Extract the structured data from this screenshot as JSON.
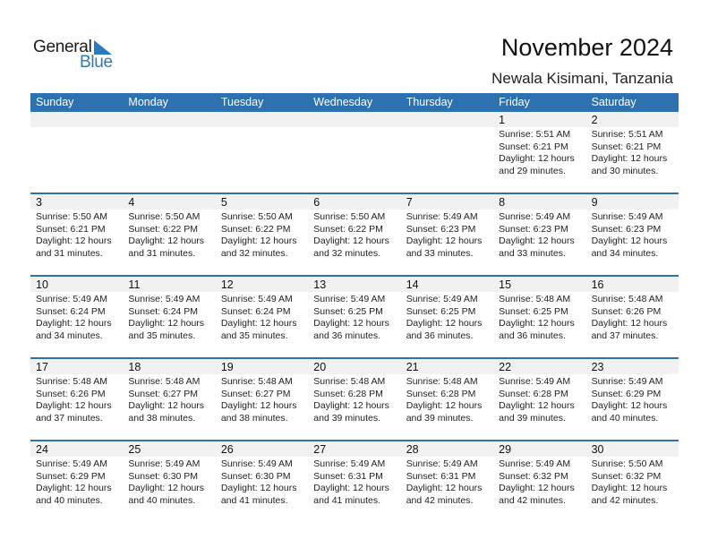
{
  "logo": {
    "word1": "General",
    "word2": "Blue",
    "accent": "#2a7ac0"
  },
  "header": {
    "title": "November 2024",
    "location": "Newala Kisimani, Tanzania"
  },
  "colors": {
    "header_bg": "#2e71b1",
    "date_row_bg": "#f1f1f1"
  },
  "weekdays": [
    "Sunday",
    "Monday",
    "Tuesday",
    "Wednesday",
    "Thursday",
    "Friday",
    "Saturday"
  ],
  "weeks": [
    [
      null,
      null,
      null,
      null,
      null,
      {
        "day": "1",
        "sunrise": "Sunrise: 5:51 AM",
        "sunset": "Sunset: 6:21 PM",
        "daylight1": "Daylight: 12 hours",
        "daylight2": "and 29 minutes."
      },
      {
        "day": "2",
        "sunrise": "Sunrise: 5:51 AM",
        "sunset": "Sunset: 6:21 PM",
        "daylight1": "Daylight: 12 hours",
        "daylight2": "and 30 minutes."
      }
    ],
    [
      {
        "day": "3",
        "sunrise": "Sunrise: 5:50 AM",
        "sunset": "Sunset: 6:21 PM",
        "daylight1": "Daylight: 12 hours",
        "daylight2": "and 31 minutes."
      },
      {
        "day": "4",
        "sunrise": "Sunrise: 5:50 AM",
        "sunset": "Sunset: 6:22 PM",
        "daylight1": "Daylight: 12 hours",
        "daylight2": "and 31 minutes."
      },
      {
        "day": "5",
        "sunrise": "Sunrise: 5:50 AM",
        "sunset": "Sunset: 6:22 PM",
        "daylight1": "Daylight: 12 hours",
        "daylight2": "and 32 minutes."
      },
      {
        "day": "6",
        "sunrise": "Sunrise: 5:50 AM",
        "sunset": "Sunset: 6:22 PM",
        "daylight1": "Daylight: 12 hours",
        "daylight2": "and 32 minutes."
      },
      {
        "day": "7",
        "sunrise": "Sunrise: 5:49 AM",
        "sunset": "Sunset: 6:23 PM",
        "daylight1": "Daylight: 12 hours",
        "daylight2": "and 33 minutes."
      },
      {
        "day": "8",
        "sunrise": "Sunrise: 5:49 AM",
        "sunset": "Sunset: 6:23 PM",
        "daylight1": "Daylight: 12 hours",
        "daylight2": "and 33 minutes."
      },
      {
        "day": "9",
        "sunrise": "Sunrise: 5:49 AM",
        "sunset": "Sunset: 6:23 PM",
        "daylight1": "Daylight: 12 hours",
        "daylight2": "and 34 minutes."
      }
    ],
    [
      {
        "day": "10",
        "sunrise": "Sunrise: 5:49 AM",
        "sunset": "Sunset: 6:24 PM",
        "daylight1": "Daylight: 12 hours",
        "daylight2": "and 34 minutes."
      },
      {
        "day": "11",
        "sunrise": "Sunrise: 5:49 AM",
        "sunset": "Sunset: 6:24 PM",
        "daylight1": "Daylight: 12 hours",
        "daylight2": "and 35 minutes."
      },
      {
        "day": "12",
        "sunrise": "Sunrise: 5:49 AM",
        "sunset": "Sunset: 6:24 PM",
        "daylight1": "Daylight: 12 hours",
        "daylight2": "and 35 minutes."
      },
      {
        "day": "13",
        "sunrise": "Sunrise: 5:49 AM",
        "sunset": "Sunset: 6:25 PM",
        "daylight1": "Daylight: 12 hours",
        "daylight2": "and 36 minutes."
      },
      {
        "day": "14",
        "sunrise": "Sunrise: 5:49 AM",
        "sunset": "Sunset: 6:25 PM",
        "daylight1": "Daylight: 12 hours",
        "daylight2": "and 36 minutes."
      },
      {
        "day": "15",
        "sunrise": "Sunrise: 5:48 AM",
        "sunset": "Sunset: 6:25 PM",
        "daylight1": "Daylight: 12 hours",
        "daylight2": "and 36 minutes."
      },
      {
        "day": "16",
        "sunrise": "Sunrise: 5:48 AM",
        "sunset": "Sunset: 6:26 PM",
        "daylight1": "Daylight: 12 hours",
        "daylight2": "and 37 minutes."
      }
    ],
    [
      {
        "day": "17",
        "sunrise": "Sunrise: 5:48 AM",
        "sunset": "Sunset: 6:26 PM",
        "daylight1": "Daylight: 12 hours",
        "daylight2": "and 37 minutes."
      },
      {
        "day": "18",
        "sunrise": "Sunrise: 5:48 AM",
        "sunset": "Sunset: 6:27 PM",
        "daylight1": "Daylight: 12 hours",
        "daylight2": "and 38 minutes."
      },
      {
        "day": "19",
        "sunrise": "Sunrise: 5:48 AM",
        "sunset": "Sunset: 6:27 PM",
        "daylight1": "Daylight: 12 hours",
        "daylight2": "and 38 minutes."
      },
      {
        "day": "20",
        "sunrise": "Sunrise: 5:48 AM",
        "sunset": "Sunset: 6:28 PM",
        "daylight1": "Daylight: 12 hours",
        "daylight2": "and 39 minutes."
      },
      {
        "day": "21",
        "sunrise": "Sunrise: 5:48 AM",
        "sunset": "Sunset: 6:28 PM",
        "daylight1": "Daylight: 12 hours",
        "daylight2": "and 39 minutes."
      },
      {
        "day": "22",
        "sunrise": "Sunrise: 5:49 AM",
        "sunset": "Sunset: 6:28 PM",
        "daylight1": "Daylight: 12 hours",
        "daylight2": "and 39 minutes."
      },
      {
        "day": "23",
        "sunrise": "Sunrise: 5:49 AM",
        "sunset": "Sunset: 6:29 PM",
        "daylight1": "Daylight: 12 hours",
        "daylight2": "and 40 minutes."
      }
    ],
    [
      {
        "day": "24",
        "sunrise": "Sunrise: 5:49 AM",
        "sunset": "Sunset: 6:29 PM",
        "daylight1": "Daylight: 12 hours",
        "daylight2": "and 40 minutes."
      },
      {
        "day": "25",
        "sunrise": "Sunrise: 5:49 AM",
        "sunset": "Sunset: 6:30 PM",
        "daylight1": "Daylight: 12 hours",
        "daylight2": "and 40 minutes."
      },
      {
        "day": "26",
        "sunrise": "Sunrise: 5:49 AM",
        "sunset": "Sunset: 6:30 PM",
        "daylight1": "Daylight: 12 hours",
        "daylight2": "and 41 minutes."
      },
      {
        "day": "27",
        "sunrise": "Sunrise: 5:49 AM",
        "sunset": "Sunset: 6:31 PM",
        "daylight1": "Daylight: 12 hours",
        "daylight2": "and 41 minutes."
      },
      {
        "day": "28",
        "sunrise": "Sunrise: 5:49 AM",
        "sunset": "Sunset: 6:31 PM",
        "daylight1": "Daylight: 12 hours",
        "daylight2": "and 42 minutes."
      },
      {
        "day": "29",
        "sunrise": "Sunrise: 5:49 AM",
        "sunset": "Sunset: 6:32 PM",
        "daylight1": "Daylight: 12 hours",
        "daylight2": "and 42 minutes."
      },
      {
        "day": "30",
        "sunrise": "Sunrise: 5:50 AM",
        "sunset": "Sunset: 6:32 PM",
        "daylight1": "Daylight: 12 hours",
        "daylight2": "and 42 minutes."
      }
    ]
  ]
}
